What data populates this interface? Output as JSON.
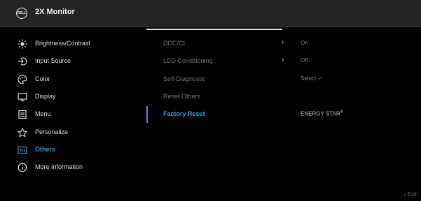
{
  "header": {
    "logo_text": "DELL",
    "title": "2X Monitor"
  },
  "sidebar": {
    "items": [
      {
        "label": "Brightness/Contrast",
        "icon": "brightness-icon"
      },
      {
        "label": "Input Source",
        "icon": "input-source-icon"
      },
      {
        "label": "Color",
        "icon": "color-palette-icon"
      },
      {
        "label": "Display",
        "icon": "display-icon"
      },
      {
        "label": "Menu",
        "icon": "menu-icon"
      },
      {
        "label": "Personalize",
        "icon": "star-icon"
      },
      {
        "label": "Others",
        "icon": "others-icon",
        "active": true
      },
      {
        "label": "More Information",
        "icon": "info-icon"
      }
    ]
  },
  "submenu": {
    "items": [
      {
        "label": "DDC/CI",
        "arrow": "›",
        "value": "On"
      },
      {
        "label": "LCD Conditioning",
        "arrow": "›",
        "value": "Off"
      },
      {
        "label": "Self-Diagnostic",
        "value": "Select ✓"
      },
      {
        "label": "Reset Others",
        "value": ""
      },
      {
        "label": "Factory Reset",
        "active": true,
        "value": "ENERGY STAR",
        "value_sup": "®"
      }
    ]
  },
  "footer": {
    "exit_label": "Exit",
    "exit_icon": "chevron-left-icon"
  },
  "colors": {
    "accent": "#2b9cdc",
    "header_bg": "#242424",
    "background": "#000000"
  }
}
